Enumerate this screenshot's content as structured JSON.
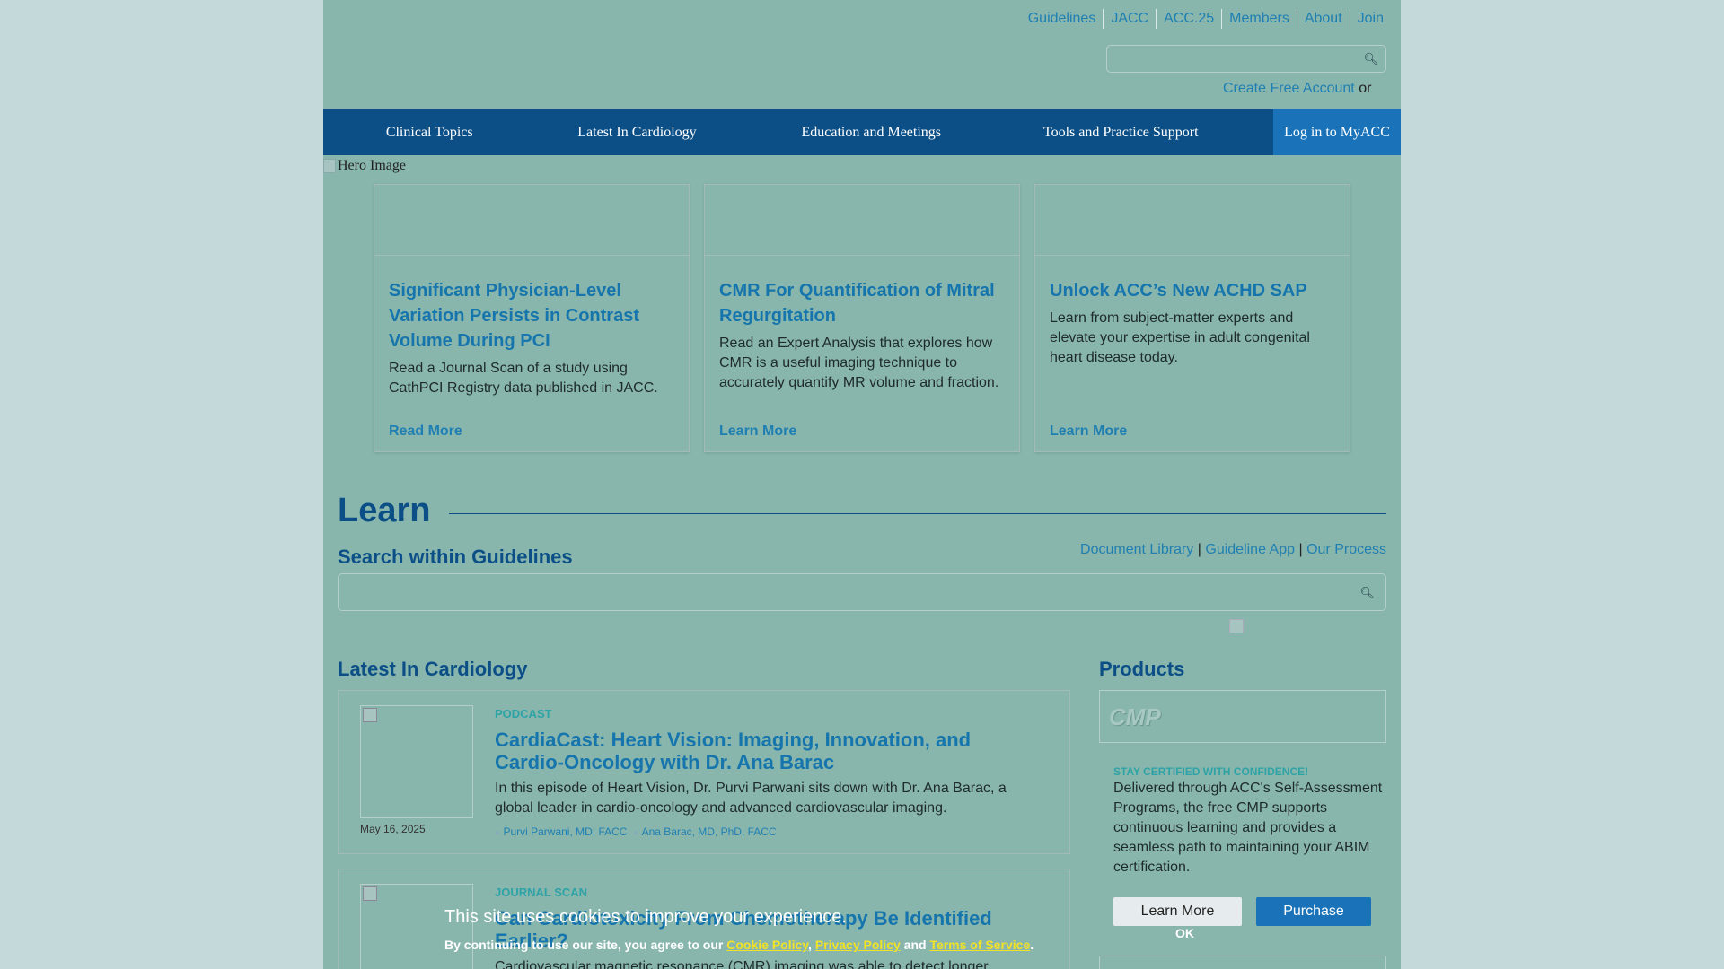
{
  "header": {
    "top_links": [
      "Guidelines",
      "JACC",
      "ACC.25",
      "Members",
      "About",
      "Join"
    ],
    "create_account": "Create Free Account",
    "or": "or"
  },
  "nav": {
    "home_icon": "home-icon",
    "items": [
      "Clinical Topics",
      "Latest In Cardiology",
      "Education and Meetings",
      "Tools and Practice Support"
    ],
    "login": " Log in to MyACC"
  },
  "hero": {
    "alt": "Hero Image"
  },
  "cards": [
    {
      "title": "Significant Physician-Level Variation Persists in Contrast Volume During PCI",
      "desc": "Read a Journal Scan of a study using CathPCI Registry data published in JACC.",
      "link": "Read More  "
    },
    {
      "title": "CMR For Quantification of Mitral Regurgitation",
      "desc": "Read an Expert Analysis that explores how CMR is a useful imaging technique to accurately quantify MR volume and fraction.",
      "link": "Learn More  "
    },
    {
      "title": "Unlock ACC’s New ACHD SAP",
      "desc": "Learn from subject-matter experts and elevate your expertise in adult congenital heart disease today.",
      "link": "Learn More  "
    }
  ],
  "learn": {
    "title": "Learn",
    "search_title": "Search within Guidelines",
    "links": [
      "Document Library",
      "Guideline App",
      "Our Process"
    ],
    "sep": "|"
  },
  "latest": {
    "title": "Latest In Cardiology",
    "articles": [
      {
        "category": "PODCAST",
        "title": "CardiaCast: Heart Vision: Imaging, Innovation, and Cardio-Oncology with Dr. Ana Barac",
        "desc": "In this episode of Heart Vision, Dr. Purvi Parwani sits down with Dr. Ana Barac, a global leader in cardio-oncology and advanced cardiovascular imaging.",
        "date": "May 16, 2025",
        "authors": [
          "Purvi Parwani, MD, FACC",
          "Ana Barac, MD, PhD, FACC"
        ]
      },
      {
        "category": "JOURNAL SCAN",
        "title": "Can Cardiotoxicity From Chemotherapy Be Identified Earlier?",
        "desc": "Cardiovascular magnetic resonance (CMR) imaging was able to detect longer"
      }
    ]
  },
  "products": {
    "title": "Products",
    "logo_text": "CMP",
    "kicker": "STAY CERTIFIED WITH CONFIDENCE!",
    "desc": "Delivered through ACC's Self-Assessment Programs, the free CMP supports continuous learning and provides a seamless path to maintaining your ABIM certification.",
    "learn_more": "Learn More",
    "purchase": "Purchase"
  },
  "cookie": {
    "message": "This site uses cookies to improve your experience.",
    "legal_prefix": "By continuing to use our site, you agree to our",
    "cookie_policy": "Cookie Policy",
    "privacy_policy": "Privacy Policy",
    "and": "and",
    "terms": "Terms of Service",
    "ok": "OK"
  }
}
